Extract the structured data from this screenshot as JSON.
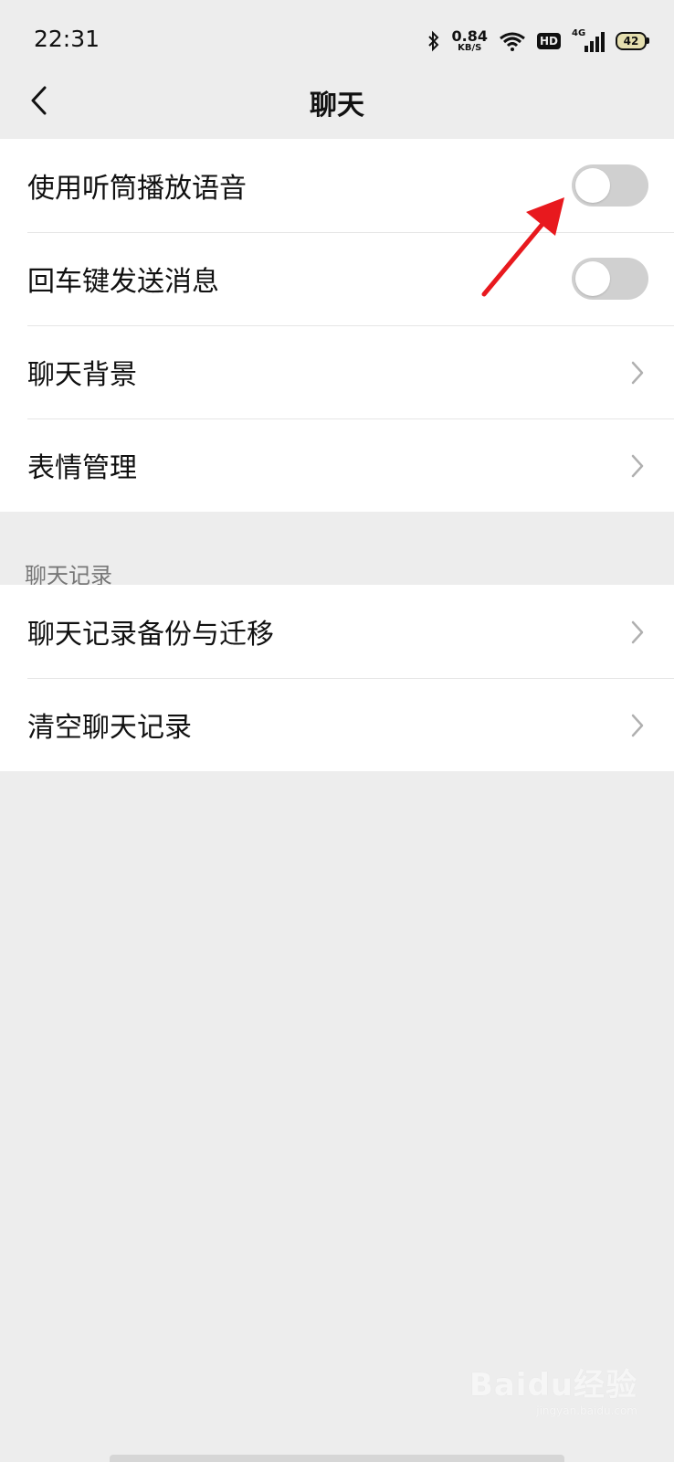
{
  "status_bar": {
    "time": "22:31",
    "net_speed_value": "0.84",
    "net_speed_unit": "KB/S",
    "hd_badge": "HD",
    "signal_label": "4G",
    "battery": "42",
    "icons": [
      "bluetooth-icon",
      "wifi-icon",
      "hd-icon",
      "signal-icon",
      "battery-icon"
    ]
  },
  "header": {
    "title": "聊天",
    "back_icon": "chevron-left-icon"
  },
  "settings": {
    "group1": [
      {
        "label": "使用听筒播放语音",
        "control": "switch",
        "on": false
      },
      {
        "label": "回车键发送消息",
        "control": "switch",
        "on": false
      },
      {
        "label": "聊天背景",
        "control": "chevron"
      },
      {
        "label": "表情管理",
        "control": "chevron"
      }
    ],
    "section2_title": "聊天记录",
    "group2": [
      {
        "label": "聊天记录备份与迁移",
        "control": "chevron"
      },
      {
        "label": "清空聊天记录",
        "control": "chevron"
      }
    ]
  },
  "annotation": {
    "color": "#e8191e"
  },
  "watermark": {
    "brand": "Baidu经验",
    "sub": "jingyan.baidu.com"
  },
  "colors": {
    "background": "#ededed",
    "switch_off": "#d0d0d0",
    "text": "#111111"
  }
}
